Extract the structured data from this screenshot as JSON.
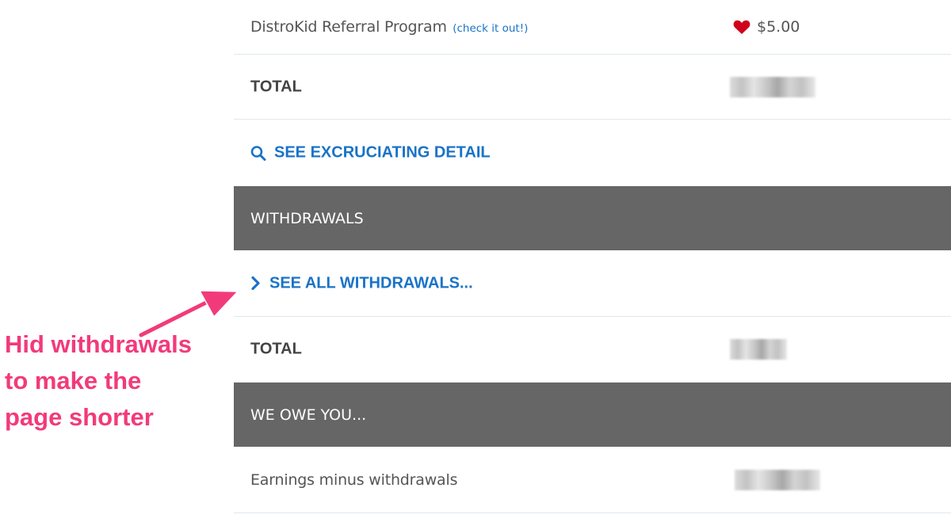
{
  "earnings": {
    "referral": {
      "label": "DistroKid Referral Program",
      "link": "(check it out!)",
      "icon": "heart-icon",
      "heart_color": "#d0021b",
      "amount": "$5.00"
    },
    "total_label": "TOTAL",
    "detail_link": "SEE EXCRUCIATING DETAIL",
    "detail_icon": "search-icon"
  },
  "withdrawals": {
    "header": "WITHDRAWALS",
    "see_all": "SEE ALL WITHDRAWALS...",
    "see_all_icon": "chevron-right-icon",
    "total_label": "TOTAL"
  },
  "we_owe": {
    "header": "WE OWE YOU...",
    "row_label": "Earnings minus withdrawals"
  },
  "annotation": {
    "lines": [
      "Hid withdrawals",
      "to make the",
      "page shorter"
    ],
    "color": "#f23a7a"
  },
  "colors": {
    "link": "#1a73c7",
    "section_header_bg": "#666666",
    "divider": "#dfe8ee"
  }
}
